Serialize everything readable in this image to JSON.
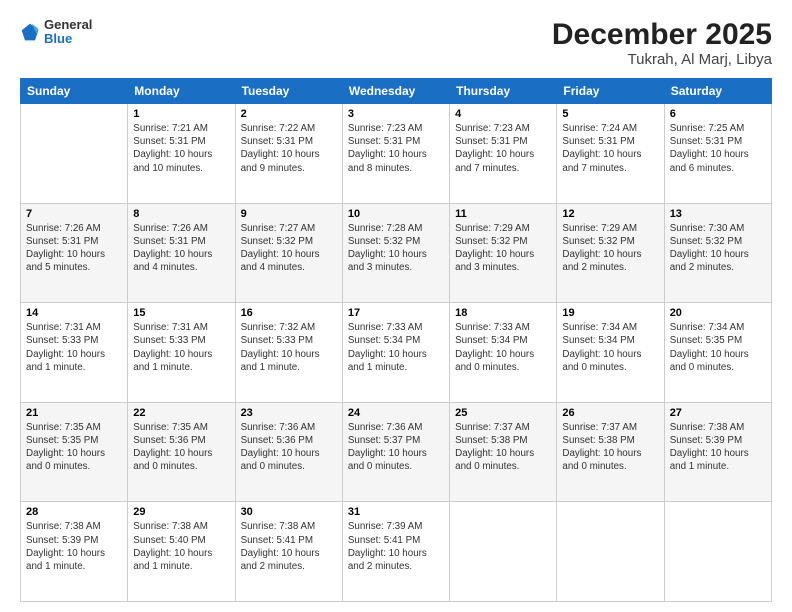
{
  "header": {
    "logo_line1": "General",
    "logo_line2": "Blue",
    "month": "December 2025",
    "location": "Tukrah, Al Marj, Libya"
  },
  "days_of_week": [
    "Sunday",
    "Monday",
    "Tuesday",
    "Wednesday",
    "Thursday",
    "Friday",
    "Saturday"
  ],
  "weeks": [
    [
      {
        "num": "",
        "info": ""
      },
      {
        "num": "1",
        "info": "Sunrise: 7:21 AM\nSunset: 5:31 PM\nDaylight: 10 hours\nand 10 minutes."
      },
      {
        "num": "2",
        "info": "Sunrise: 7:22 AM\nSunset: 5:31 PM\nDaylight: 10 hours\nand 9 minutes."
      },
      {
        "num": "3",
        "info": "Sunrise: 7:23 AM\nSunset: 5:31 PM\nDaylight: 10 hours\nand 8 minutes."
      },
      {
        "num": "4",
        "info": "Sunrise: 7:23 AM\nSunset: 5:31 PM\nDaylight: 10 hours\nand 7 minutes."
      },
      {
        "num": "5",
        "info": "Sunrise: 7:24 AM\nSunset: 5:31 PM\nDaylight: 10 hours\nand 7 minutes."
      },
      {
        "num": "6",
        "info": "Sunrise: 7:25 AM\nSunset: 5:31 PM\nDaylight: 10 hours\nand 6 minutes."
      }
    ],
    [
      {
        "num": "7",
        "info": "Sunrise: 7:26 AM\nSunset: 5:31 PM\nDaylight: 10 hours\nand 5 minutes."
      },
      {
        "num": "8",
        "info": "Sunrise: 7:26 AM\nSunset: 5:31 PM\nDaylight: 10 hours\nand 4 minutes."
      },
      {
        "num": "9",
        "info": "Sunrise: 7:27 AM\nSunset: 5:32 PM\nDaylight: 10 hours\nand 4 minutes."
      },
      {
        "num": "10",
        "info": "Sunrise: 7:28 AM\nSunset: 5:32 PM\nDaylight: 10 hours\nand 3 minutes."
      },
      {
        "num": "11",
        "info": "Sunrise: 7:29 AM\nSunset: 5:32 PM\nDaylight: 10 hours\nand 3 minutes."
      },
      {
        "num": "12",
        "info": "Sunrise: 7:29 AM\nSunset: 5:32 PM\nDaylight: 10 hours\nand 2 minutes."
      },
      {
        "num": "13",
        "info": "Sunrise: 7:30 AM\nSunset: 5:32 PM\nDaylight: 10 hours\nand 2 minutes."
      }
    ],
    [
      {
        "num": "14",
        "info": "Sunrise: 7:31 AM\nSunset: 5:33 PM\nDaylight: 10 hours\nand 1 minute."
      },
      {
        "num": "15",
        "info": "Sunrise: 7:31 AM\nSunset: 5:33 PM\nDaylight: 10 hours\nand 1 minute."
      },
      {
        "num": "16",
        "info": "Sunrise: 7:32 AM\nSunset: 5:33 PM\nDaylight: 10 hours\nand 1 minute."
      },
      {
        "num": "17",
        "info": "Sunrise: 7:33 AM\nSunset: 5:34 PM\nDaylight: 10 hours\nand 1 minute."
      },
      {
        "num": "18",
        "info": "Sunrise: 7:33 AM\nSunset: 5:34 PM\nDaylight: 10 hours\nand 0 minutes."
      },
      {
        "num": "19",
        "info": "Sunrise: 7:34 AM\nSunset: 5:34 PM\nDaylight: 10 hours\nand 0 minutes."
      },
      {
        "num": "20",
        "info": "Sunrise: 7:34 AM\nSunset: 5:35 PM\nDaylight: 10 hours\nand 0 minutes."
      }
    ],
    [
      {
        "num": "21",
        "info": "Sunrise: 7:35 AM\nSunset: 5:35 PM\nDaylight: 10 hours\nand 0 minutes."
      },
      {
        "num": "22",
        "info": "Sunrise: 7:35 AM\nSunset: 5:36 PM\nDaylight: 10 hours\nand 0 minutes."
      },
      {
        "num": "23",
        "info": "Sunrise: 7:36 AM\nSunset: 5:36 PM\nDaylight: 10 hours\nand 0 minutes."
      },
      {
        "num": "24",
        "info": "Sunrise: 7:36 AM\nSunset: 5:37 PM\nDaylight: 10 hours\nand 0 minutes."
      },
      {
        "num": "25",
        "info": "Sunrise: 7:37 AM\nSunset: 5:38 PM\nDaylight: 10 hours\nand 0 minutes."
      },
      {
        "num": "26",
        "info": "Sunrise: 7:37 AM\nSunset: 5:38 PM\nDaylight: 10 hours\nand 0 minutes."
      },
      {
        "num": "27",
        "info": "Sunrise: 7:38 AM\nSunset: 5:39 PM\nDaylight: 10 hours\nand 1 minute."
      }
    ],
    [
      {
        "num": "28",
        "info": "Sunrise: 7:38 AM\nSunset: 5:39 PM\nDaylight: 10 hours\nand 1 minute."
      },
      {
        "num": "29",
        "info": "Sunrise: 7:38 AM\nSunset: 5:40 PM\nDaylight: 10 hours\nand 1 minute."
      },
      {
        "num": "30",
        "info": "Sunrise: 7:38 AM\nSunset: 5:41 PM\nDaylight: 10 hours\nand 2 minutes."
      },
      {
        "num": "31",
        "info": "Sunrise: 7:39 AM\nSunset: 5:41 PM\nDaylight: 10 hours\nand 2 minutes."
      },
      {
        "num": "",
        "info": ""
      },
      {
        "num": "",
        "info": ""
      },
      {
        "num": "",
        "info": ""
      }
    ]
  ]
}
